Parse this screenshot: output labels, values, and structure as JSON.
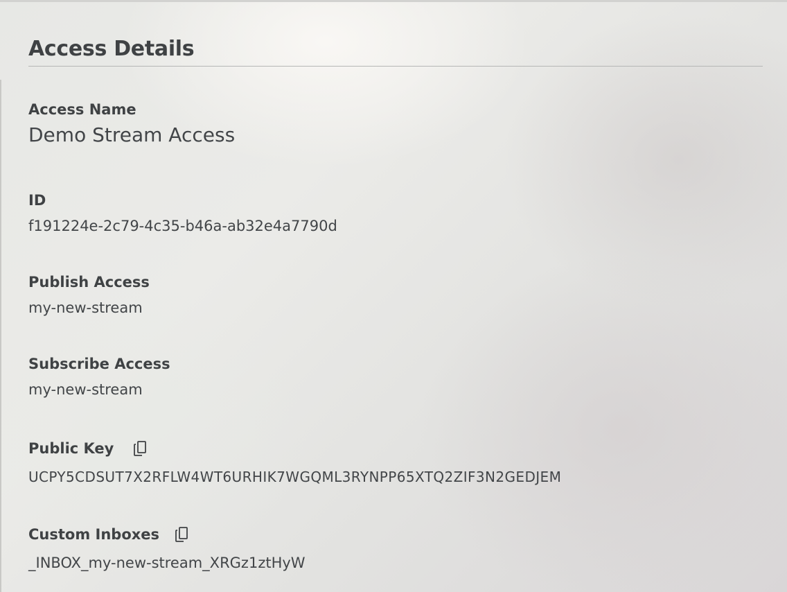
{
  "panel": {
    "title": "Access Details"
  },
  "fields": {
    "access_name": {
      "label": "Access Name",
      "value": "Demo Stream Access"
    },
    "id": {
      "label": "ID",
      "value": "f191224e-2c79-4c35-b46a-ab32e4a7790d"
    },
    "publish_access": {
      "label": "Publish Access",
      "value": "my-new-stream"
    },
    "subscribe_access": {
      "label": "Subscribe Access",
      "value": "my-new-stream"
    },
    "public_key": {
      "label": "Public Key",
      "value": "UCPY5CDSUT7X2RFLW4WT6URHIK7WGQML3RYNPP65XTQ2ZIF3N2GEDJEM",
      "icon": "copy-icon"
    },
    "custom_inboxes": {
      "label": "Custom Inboxes",
      "value": "_INBOX_my-new-stream_XRGz1ztHyW",
      "icon": "copy-icon"
    }
  },
  "colors": {
    "text": "#3f4244",
    "divider": "#b5b6b5"
  }
}
